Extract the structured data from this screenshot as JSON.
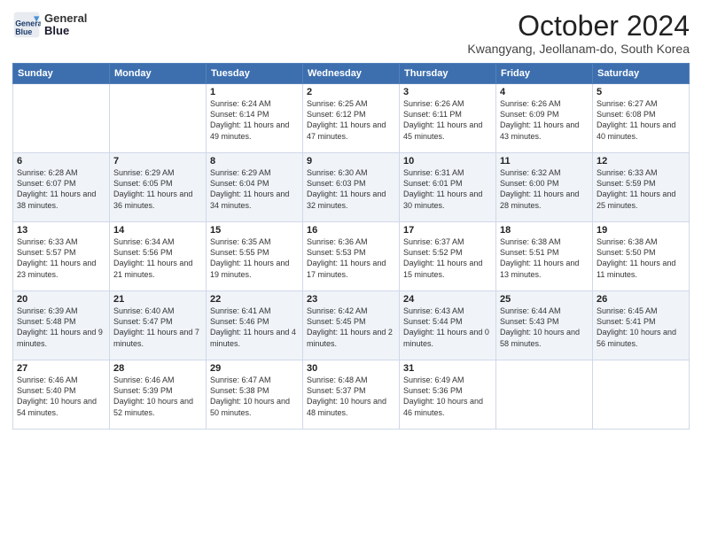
{
  "header": {
    "logo_line1": "General",
    "logo_line2": "Blue",
    "month": "October 2024",
    "location": "Kwangyang, Jeollanam-do, South Korea"
  },
  "days_of_week": [
    "Sunday",
    "Monday",
    "Tuesday",
    "Wednesday",
    "Thursday",
    "Friday",
    "Saturday"
  ],
  "weeks": [
    [
      {
        "day": "",
        "detail": ""
      },
      {
        "day": "",
        "detail": ""
      },
      {
        "day": "1",
        "detail": "Sunrise: 6:24 AM\nSunset: 6:14 PM\nDaylight: 11 hours and 49 minutes."
      },
      {
        "day": "2",
        "detail": "Sunrise: 6:25 AM\nSunset: 6:12 PM\nDaylight: 11 hours and 47 minutes."
      },
      {
        "day": "3",
        "detail": "Sunrise: 6:26 AM\nSunset: 6:11 PM\nDaylight: 11 hours and 45 minutes."
      },
      {
        "day": "4",
        "detail": "Sunrise: 6:26 AM\nSunset: 6:09 PM\nDaylight: 11 hours and 43 minutes."
      },
      {
        "day": "5",
        "detail": "Sunrise: 6:27 AM\nSunset: 6:08 PM\nDaylight: 11 hours and 40 minutes."
      }
    ],
    [
      {
        "day": "6",
        "detail": "Sunrise: 6:28 AM\nSunset: 6:07 PM\nDaylight: 11 hours and 38 minutes."
      },
      {
        "day": "7",
        "detail": "Sunrise: 6:29 AM\nSunset: 6:05 PM\nDaylight: 11 hours and 36 minutes."
      },
      {
        "day": "8",
        "detail": "Sunrise: 6:29 AM\nSunset: 6:04 PM\nDaylight: 11 hours and 34 minutes."
      },
      {
        "day": "9",
        "detail": "Sunrise: 6:30 AM\nSunset: 6:03 PM\nDaylight: 11 hours and 32 minutes."
      },
      {
        "day": "10",
        "detail": "Sunrise: 6:31 AM\nSunset: 6:01 PM\nDaylight: 11 hours and 30 minutes."
      },
      {
        "day": "11",
        "detail": "Sunrise: 6:32 AM\nSunset: 6:00 PM\nDaylight: 11 hours and 28 minutes."
      },
      {
        "day": "12",
        "detail": "Sunrise: 6:33 AM\nSunset: 5:59 PM\nDaylight: 11 hours and 25 minutes."
      }
    ],
    [
      {
        "day": "13",
        "detail": "Sunrise: 6:33 AM\nSunset: 5:57 PM\nDaylight: 11 hours and 23 minutes."
      },
      {
        "day": "14",
        "detail": "Sunrise: 6:34 AM\nSunset: 5:56 PM\nDaylight: 11 hours and 21 minutes."
      },
      {
        "day": "15",
        "detail": "Sunrise: 6:35 AM\nSunset: 5:55 PM\nDaylight: 11 hours and 19 minutes."
      },
      {
        "day": "16",
        "detail": "Sunrise: 6:36 AM\nSunset: 5:53 PM\nDaylight: 11 hours and 17 minutes."
      },
      {
        "day": "17",
        "detail": "Sunrise: 6:37 AM\nSunset: 5:52 PM\nDaylight: 11 hours and 15 minutes."
      },
      {
        "day": "18",
        "detail": "Sunrise: 6:38 AM\nSunset: 5:51 PM\nDaylight: 11 hours and 13 minutes."
      },
      {
        "day": "19",
        "detail": "Sunrise: 6:38 AM\nSunset: 5:50 PM\nDaylight: 11 hours and 11 minutes."
      }
    ],
    [
      {
        "day": "20",
        "detail": "Sunrise: 6:39 AM\nSunset: 5:48 PM\nDaylight: 11 hours and 9 minutes."
      },
      {
        "day": "21",
        "detail": "Sunrise: 6:40 AM\nSunset: 5:47 PM\nDaylight: 11 hours and 7 minutes."
      },
      {
        "day": "22",
        "detail": "Sunrise: 6:41 AM\nSunset: 5:46 PM\nDaylight: 11 hours and 4 minutes."
      },
      {
        "day": "23",
        "detail": "Sunrise: 6:42 AM\nSunset: 5:45 PM\nDaylight: 11 hours and 2 minutes."
      },
      {
        "day": "24",
        "detail": "Sunrise: 6:43 AM\nSunset: 5:44 PM\nDaylight: 11 hours and 0 minutes."
      },
      {
        "day": "25",
        "detail": "Sunrise: 6:44 AM\nSunset: 5:43 PM\nDaylight: 10 hours and 58 minutes."
      },
      {
        "day": "26",
        "detail": "Sunrise: 6:45 AM\nSunset: 5:41 PM\nDaylight: 10 hours and 56 minutes."
      }
    ],
    [
      {
        "day": "27",
        "detail": "Sunrise: 6:46 AM\nSunset: 5:40 PM\nDaylight: 10 hours and 54 minutes."
      },
      {
        "day": "28",
        "detail": "Sunrise: 6:46 AM\nSunset: 5:39 PM\nDaylight: 10 hours and 52 minutes."
      },
      {
        "day": "29",
        "detail": "Sunrise: 6:47 AM\nSunset: 5:38 PM\nDaylight: 10 hours and 50 minutes."
      },
      {
        "day": "30",
        "detail": "Sunrise: 6:48 AM\nSunset: 5:37 PM\nDaylight: 10 hours and 48 minutes."
      },
      {
        "day": "31",
        "detail": "Sunrise: 6:49 AM\nSunset: 5:36 PM\nDaylight: 10 hours and 46 minutes."
      },
      {
        "day": "",
        "detail": ""
      },
      {
        "day": "",
        "detail": ""
      }
    ]
  ]
}
